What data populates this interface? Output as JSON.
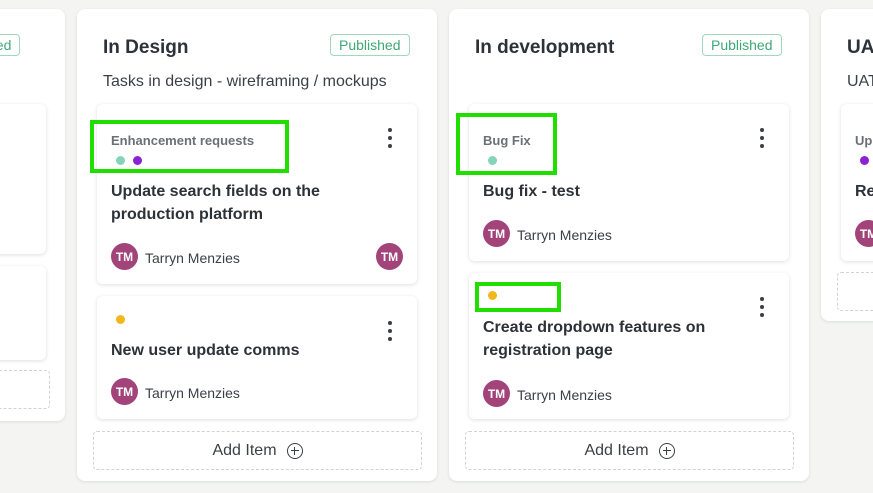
{
  "colors": {
    "teal_dot": "#86d4b7",
    "purple_dot": "#8a22d6",
    "yellow_dot": "#f2b71a",
    "avatar": "#a2447a",
    "published": "#3fa877",
    "highlight": "#22dd00"
  },
  "left_column": {
    "badge": "shed"
  },
  "design_column": {
    "title": "In Design",
    "badge": "Published",
    "description": "Tasks in design - wireframing / mockups",
    "cards": [
      {
        "category": "Enhancement requests",
        "title": "Update search fields on the production platform",
        "assignee_initials": "TM",
        "assignee_name": "Tarryn Menzies",
        "extra_avatar": "TM"
      },
      {
        "category": "",
        "title": "New user update comms",
        "assignee_initials": "TM",
        "assignee_name": "Tarryn Menzies"
      }
    ],
    "add_item": "Add Item"
  },
  "dev_column": {
    "title": "In development",
    "badge": "Published",
    "cards": [
      {
        "category": "Bug Fix",
        "title": "Bug fix - test",
        "assignee_initials": "TM",
        "assignee_name": "Tarryn Menzies"
      },
      {
        "category": "",
        "title": "Create dropdown features on registration page",
        "assignee_initials": "TM",
        "assignee_name": "Tarryn Menzies"
      }
    ],
    "add_item": "Add Item"
  },
  "uat_column": {
    "title": "UAT",
    "description": "UAT",
    "card_category": "Up",
    "card_title": "Re",
    "assignee_initials": "TM"
  }
}
